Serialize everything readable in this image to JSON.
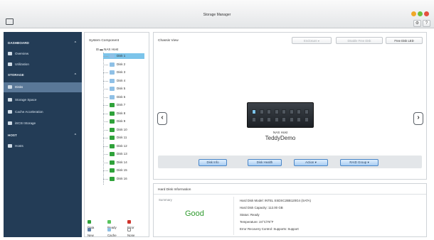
{
  "window": {
    "title": "Storage Manager"
  },
  "colors": {
    "sidebar": "#233c56",
    "selected": "#7cc4ea",
    "good": "#2f9a2e",
    "legend": {
      "data": "#2fa23a",
      "ready": "#59c45d",
      "error": "#d0342c",
      "new": "#5f7fa8",
      "cache": "#8fc0e6",
      "none": "#ffffff"
    }
  },
  "sidebar": {
    "sections": [
      {
        "label": "DASHBOARD",
        "items": [
          {
            "label": "Overview",
            "icon": "overview-icon"
          },
          {
            "label": "Utilization",
            "icon": "utilization-icon"
          }
        ]
      },
      {
        "label": "STORAGE",
        "items": [
          {
            "label": "Disks",
            "icon": "disks-icon",
            "active": true
          },
          {
            "label": "Storage Space",
            "icon": "storage-space-icon"
          },
          {
            "label": "Cache Acceleration",
            "icon": "cache-icon"
          },
          {
            "label": "iSCSI Storage",
            "icon": "iscsi-icon"
          }
        ]
      },
      {
        "label": "HOST",
        "items": [
          {
            "label": "Hosts",
            "icon": "hosts-icon"
          }
        ]
      }
    ]
  },
  "tree": {
    "title": "System Component",
    "root": "NAS Host",
    "disks": [
      "Disk 1",
      "Disk 2",
      "Disk 3",
      "Disk 4",
      "Disk 5",
      "Disk 6",
      "Disk 7",
      "Disk 8",
      "Disk 9",
      "Disk 10",
      "Disk 11",
      "Disk 12",
      "Disk 13",
      "Disk 14",
      "Disk 15",
      "Disk 16"
    ],
    "selected_index": 0,
    "legend": [
      {
        "label": "Data",
        "key": "data"
      },
      {
        "label": "Ready",
        "key": "ready"
      },
      {
        "label": "Error",
        "key": "error"
      },
      {
        "label": "New",
        "key": "new"
      },
      {
        "label": "Cache",
        "key": "cache"
      },
      {
        "label": "None",
        "key": "none"
      }
    ]
  },
  "chassis": {
    "title": "Chassis View",
    "toolbar": {
      "enclosure": "Enclosure",
      "disable_free_disk": "Disable Free Disk",
      "free_disk_led": "Free Disk LED"
    },
    "device_sub": "NAS Host",
    "device_name": "TeddyDemo",
    "actions": [
      "Disk Info",
      "Disk Health",
      "Action ▾",
      "RAID Group ▾"
    ]
  },
  "info": {
    "title": "Hard Disk Information",
    "summary_label": "Summary",
    "summary_value": "Good",
    "lines": [
      "Hard Disk Model: INTEL SSDSC2BB120G4 (SATA)",
      "Hard Disk Capacity: 112.00 GB",
      "Status: Ready",
      "Temperature: 24°C/75°F",
      "Error Recovery Control: Supports: Support"
    ]
  }
}
